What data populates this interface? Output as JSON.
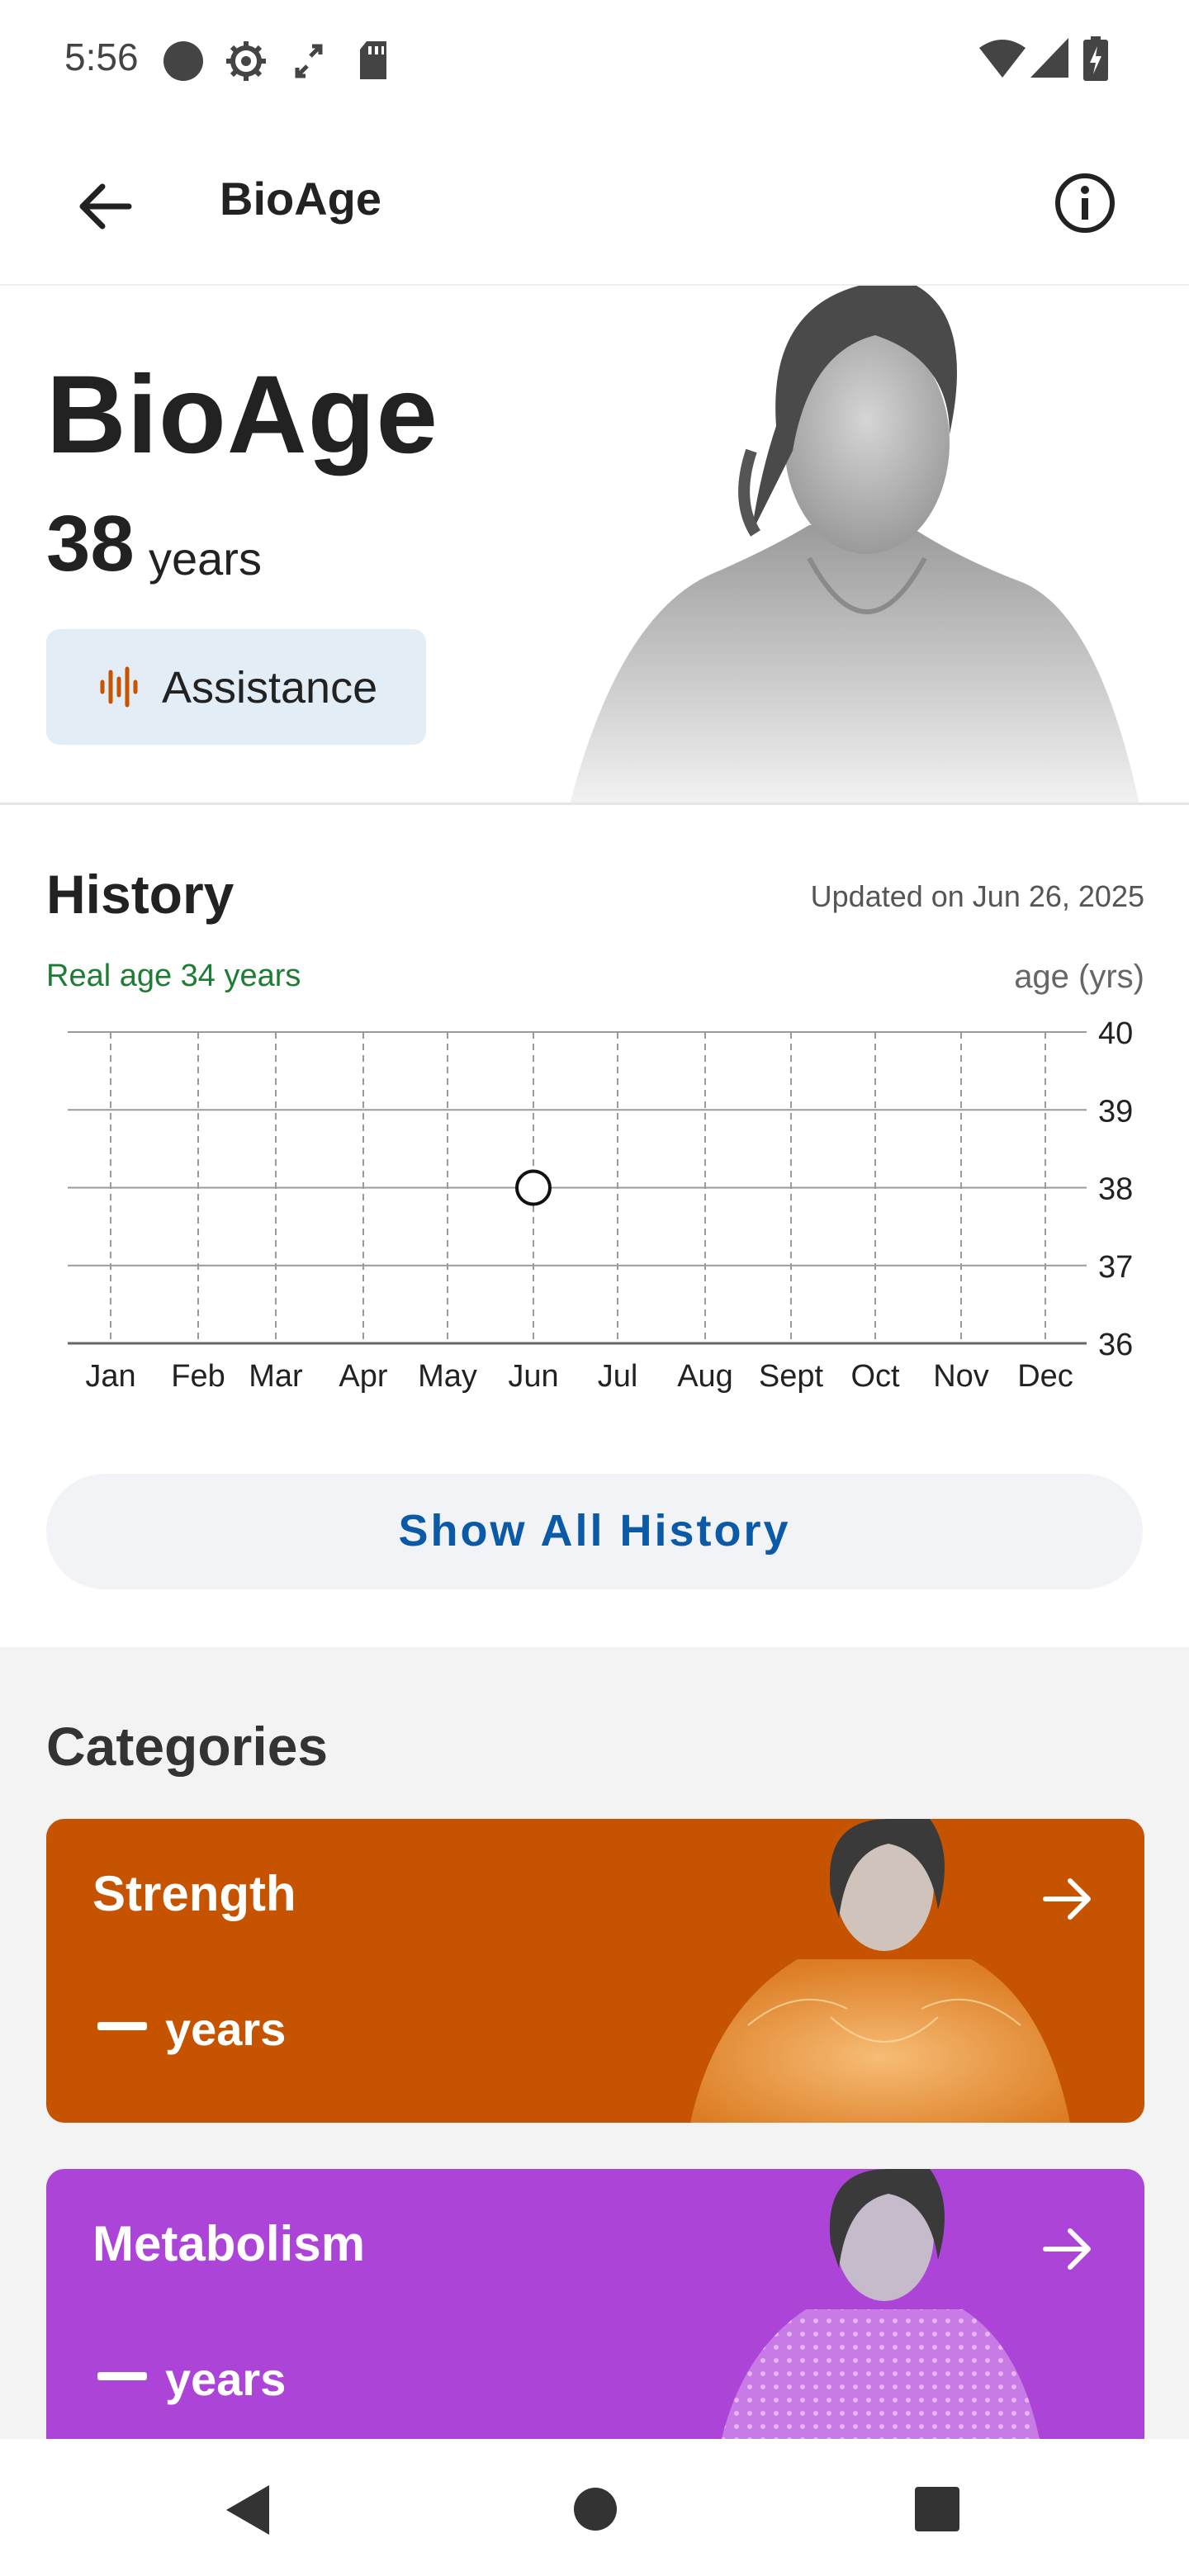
{
  "status_bar": {
    "time": "5:56"
  },
  "app_bar": {
    "title": "BioAge"
  },
  "hero": {
    "title": "BioAge",
    "age_value": "38",
    "age_unit": "years",
    "assistance_label": "Assistance"
  },
  "history": {
    "title": "History",
    "updated": "Updated on Jun 26, 2025",
    "real_age": "Real age 34 years",
    "unit_label": "age (yrs)",
    "show_all_label": "Show All History"
  },
  "chart_data": {
    "type": "scatter",
    "categories": [
      "Jan",
      "Feb",
      "Mar",
      "Apr",
      "May",
      "Jun",
      "Jul",
      "Aug",
      "Sept",
      "Oct",
      "Nov",
      "Dec"
    ],
    "y_ticks": [
      40,
      39,
      38,
      37,
      36
    ],
    "ylim": [
      36,
      40
    ],
    "ylabel": "age (yrs)",
    "points": [
      {
        "x": "Jun",
        "y": 38
      }
    ],
    "grid": true
  },
  "categories": {
    "heading": "Categories",
    "items": [
      {
        "name": "Strength",
        "value_unit": "years",
        "color": "#c65300"
      },
      {
        "name": "Metabolism",
        "value_unit": "years",
        "color": "#ac44d8"
      }
    ]
  },
  "colors": {
    "accent_blue": "#0a5aa8",
    "real_age_green": "#1e7d34",
    "assist_bg": "#e3edf5"
  }
}
